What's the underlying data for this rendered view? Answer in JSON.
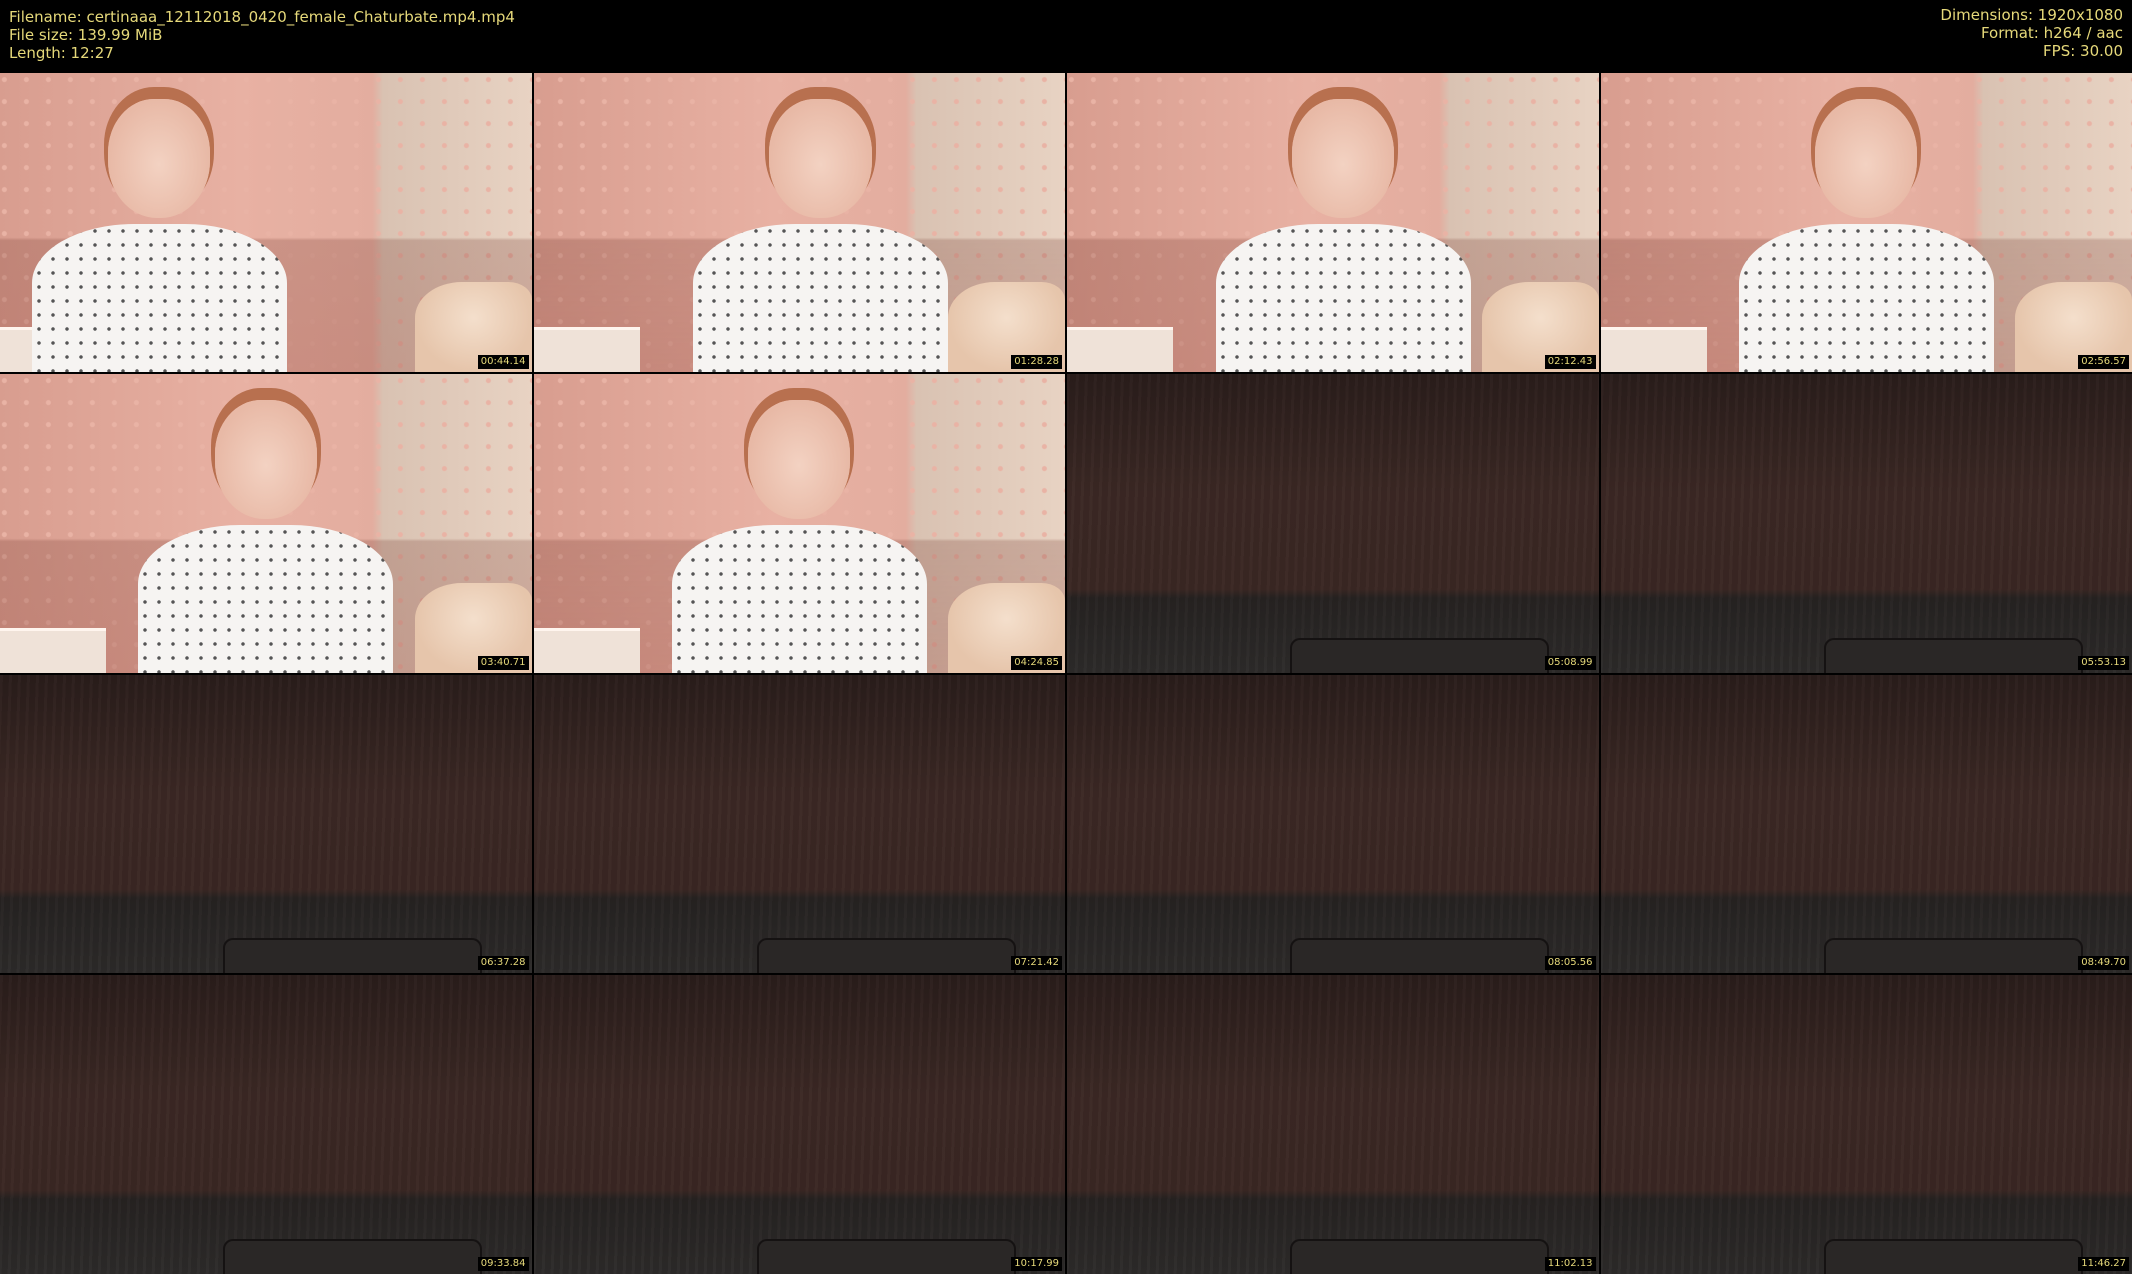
{
  "header": {
    "filename": "Filename: certinaaa_12112018_0420_female_Chaturbate.mp4.mp4",
    "filesize": "File size: 139.99 MiB",
    "length": "Length: 12:27",
    "dimensions": "Dimensions: 1920x1080",
    "format": "Format: h264 / aac",
    "fps": "FPS: 30.00"
  },
  "colors": {
    "background": "#000000",
    "header_text": "#e6d97a",
    "timestamp_text": "#e6d97a"
  },
  "thumbnails": [
    {
      "timestamp": "00:44.14",
      "scene": "room"
    },
    {
      "timestamp": "01:28.28",
      "scene": "room"
    },
    {
      "timestamp": "02:12.43",
      "scene": "room"
    },
    {
      "timestamp": "02:56.57",
      "scene": "room"
    },
    {
      "timestamp": "03:40.71",
      "scene": "room"
    },
    {
      "timestamp": "04:24.85",
      "scene": "room"
    },
    {
      "timestamp": "05:08.99",
      "scene": "dark"
    },
    {
      "timestamp": "05:53.13",
      "scene": "dark"
    },
    {
      "timestamp": "06:37.28",
      "scene": "dark"
    },
    {
      "timestamp": "07:21.42",
      "scene": "dark"
    },
    {
      "timestamp": "08:05.56",
      "scene": "dark"
    },
    {
      "timestamp": "08:49.70",
      "scene": "dark"
    },
    {
      "timestamp": "09:33.84",
      "scene": "dark"
    },
    {
      "timestamp": "10:17.99",
      "scene": "dark"
    },
    {
      "timestamp": "11:02.13",
      "scene": "dark"
    },
    {
      "timestamp": "11:46.27",
      "scene": "dark"
    }
  ]
}
